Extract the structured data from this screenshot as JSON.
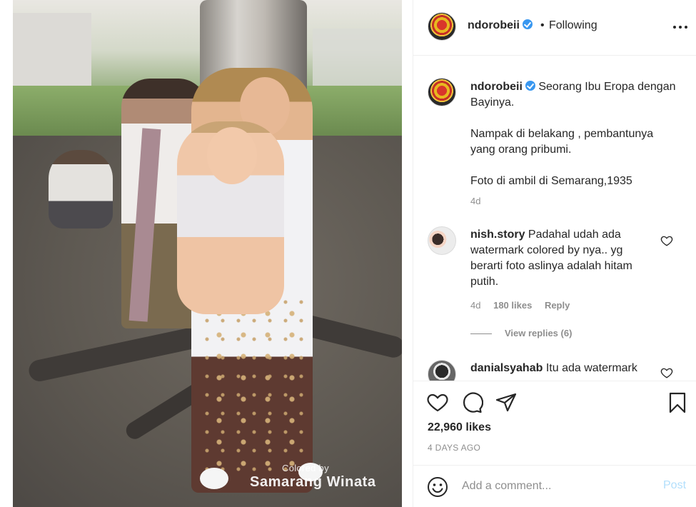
{
  "photo": {
    "watermark_small": "Colored by",
    "watermark_big": "Samarang Winata"
  },
  "header": {
    "username": "ndorobeii",
    "separator": "•",
    "follow_status": "Following",
    "more_icon": "more-horizontal-icon"
  },
  "caption": {
    "username": "ndorobeii",
    "line1": "Seorang Ibu Eropa dengan Bayinya.",
    "line2": "Nampak di belakang , pembantunya yang orang pribumi.",
    "line3": "Foto di ambil di Semarang,1935",
    "time": "4d"
  },
  "comments": [
    {
      "username": "nish.story",
      "text": "Padahal udah ada watermark colored by nya.. yg berarti foto aslinya adalah hitam putih.",
      "time": "4d",
      "likes": "180 likes",
      "reply": "Reply",
      "view_replies": "View replies (6)"
    },
    {
      "username": "danialsyahab",
      "text": "Itu ada watermark"
    }
  ],
  "actions": {
    "likes": "22,960 likes",
    "date": "4 DAYS AGO"
  },
  "add_comment": {
    "placeholder": "Add a comment...",
    "post_label": "Post"
  },
  "colors": {
    "accent": "#3897f0",
    "post_disabled": "#b2dffc",
    "muted": "#8e8e8e",
    "text": "#262626"
  }
}
